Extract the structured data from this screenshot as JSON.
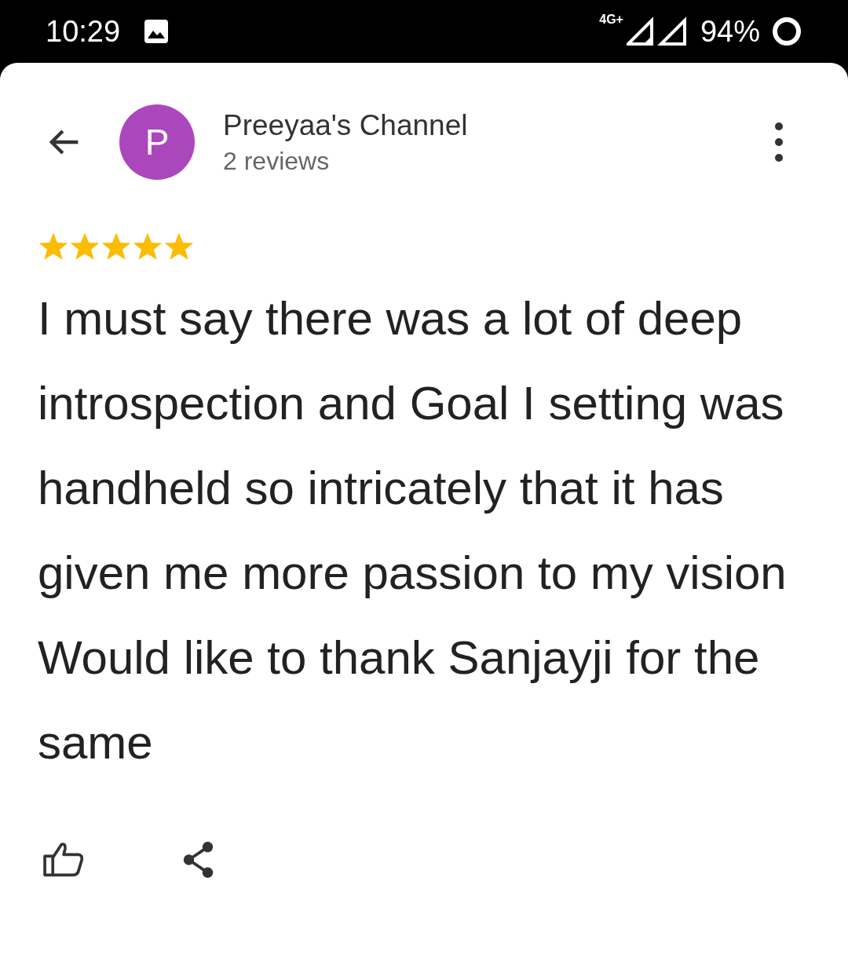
{
  "status_bar": {
    "time": "10:29",
    "network": "4G+",
    "battery": "94%"
  },
  "header": {
    "avatar_letter": "P",
    "name": "Preeyaa's Channel",
    "subtitle": "2 reviews"
  },
  "review": {
    "stars": 5,
    "text": "I must say there was a lot of deep introspection and Goal I setting was handheld so intricately that it has given me more passion to my vision Would like to thank Sanjayji for the same"
  }
}
